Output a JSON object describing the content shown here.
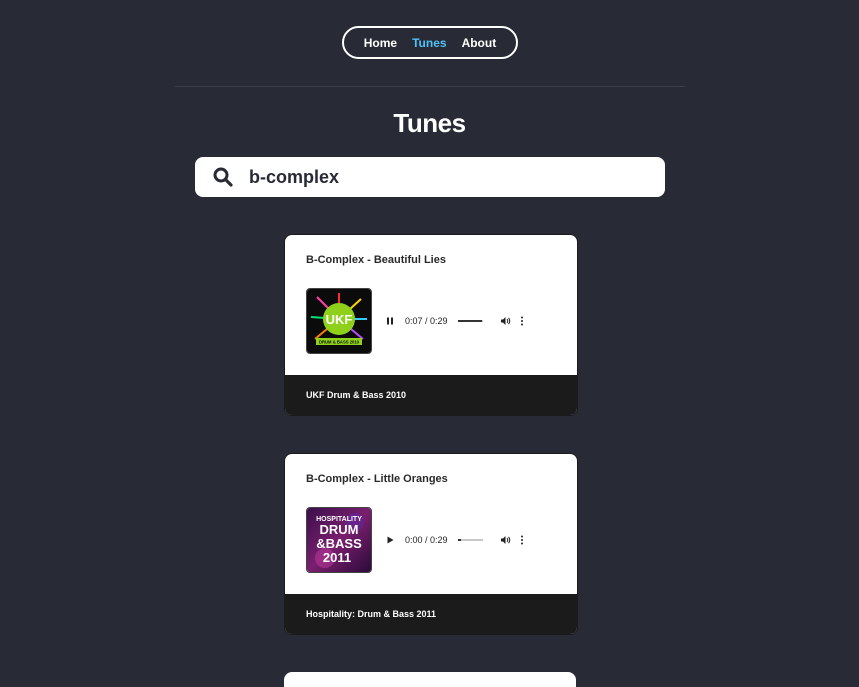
{
  "nav": {
    "items": [
      {
        "label": "Home",
        "active": false
      },
      {
        "label": "Tunes",
        "active": true
      },
      {
        "label": "About",
        "active": false
      }
    ]
  },
  "page": {
    "title": "Tunes"
  },
  "search": {
    "value": "b-complex",
    "icon": "search-icon"
  },
  "tunes": [
    {
      "title": "B-Complex - Beautiful Lies",
      "album": "UKF Drum & Bass 2010",
      "player": {
        "state": "playing",
        "time": "0:07 / 0:29",
        "progress": 0.24
      }
    },
    {
      "title": "B-Complex - Little Oranges",
      "album": "Hospitality: Drum & Bass 2011",
      "player": {
        "state": "paused",
        "time": "0:00 / 0:29",
        "progress": 0.0
      }
    }
  ],
  "colors": {
    "background": "#282a35",
    "accent": "#4fc3f7",
    "card_footer": "#1b1b1b"
  },
  "covers": {
    "ukf_text": "UKF",
    "ukf_sub": "DRUM & BASS 2010",
    "hosp_lines": [
      "HOSPITALITY",
      "DRUM",
      "&BASS",
      "2011"
    ]
  }
}
